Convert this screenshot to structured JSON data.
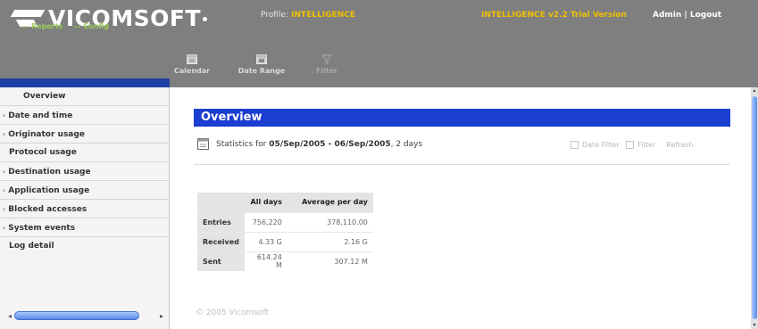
{
  "header": {
    "logo_text": "VICOMSOFT",
    "nav": [
      "Reports",
      "Config"
    ],
    "profile_label": "Profile:",
    "profile_value": "INTELLIGENCE",
    "version": "INTELLIGENCE v2.2 Trial Version",
    "admin": "Admin",
    "divider": "|",
    "logout": "Logout"
  },
  "toolbar": {
    "calendar": "Calendar",
    "date_range": "Date Range",
    "filter": "Filter"
  },
  "sidebar": {
    "items": [
      {
        "label": "Overview",
        "arrow": false
      },
      {
        "label": "Date and time",
        "arrow": true
      },
      {
        "label": "Originator usage",
        "arrow": true
      },
      {
        "label": "Protocol usage",
        "arrow": false
      },
      {
        "label": "Destination usage",
        "arrow": true
      },
      {
        "label": "Application usage",
        "arrow": true
      },
      {
        "label": "Blocked accesses",
        "arrow": true
      },
      {
        "label": "System events",
        "arrow": true
      },
      {
        "label": "Log detail",
        "arrow": false
      }
    ]
  },
  "main": {
    "title": "Overview",
    "stats_prefix": "Statistics for",
    "date_range": "05/Sep/2005 - 06/Sep/2005",
    "days": ", 2 days",
    "date_filter": "Date Filter",
    "filter": "Filter",
    "refresh": "Refresh",
    "table": {
      "headers": [
        "",
        "All days",
        "Average per day"
      ],
      "rows": [
        {
          "label": "Entries",
          "all": "756,220",
          "avg": "378,110.00"
        },
        {
          "label": "Received",
          "all": "4.33 G",
          "avg": "2.16 G"
        },
        {
          "label": "Sent",
          "all": "614.24 M",
          "avg": "307.12 M"
        }
      ]
    },
    "footer": "© 2005 Vicomsoft"
  },
  "colors": {
    "header_bg": "#7f7f7f",
    "accent_blue": "#1a3ed0",
    "nav_green": "#9acd5a",
    "profile_yellow": "#f0c000"
  },
  "icons": [
    "calendar-icon",
    "date-range-icon",
    "filter-icon",
    "small-calendar-icon"
  ]
}
